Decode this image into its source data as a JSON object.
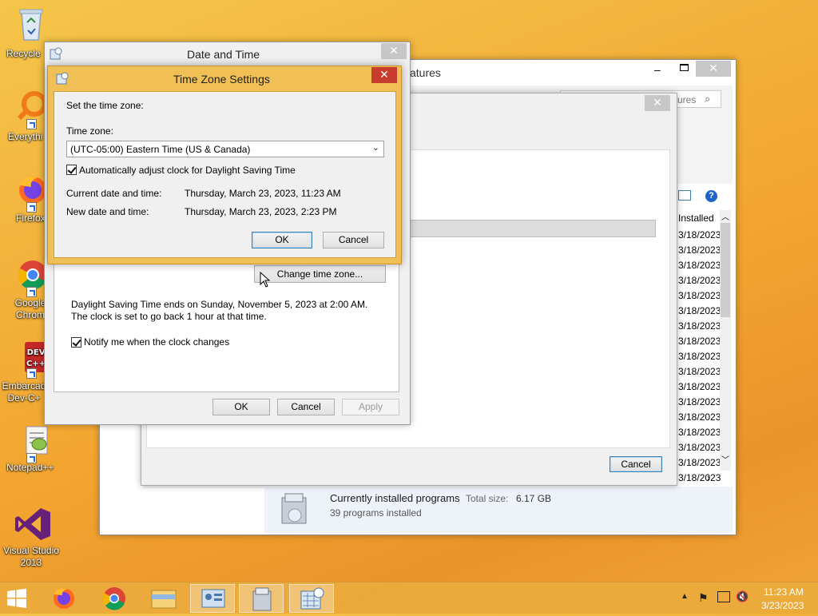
{
  "desktop": {
    "icons": [
      {
        "label": "Recycle"
      },
      {
        "label": "Everythi"
      },
      {
        "label": "Firefox"
      },
      {
        "label": "Google Chrom"
      },
      {
        "label": "Embarcad Dev-C+"
      },
      {
        "label": "Notepad++"
      },
      {
        "label": "Visual Studio 2013"
      }
    ]
  },
  "programs_window": {
    "title_partial": "atures",
    "search_placeholder_partial": "ures",
    "column_header": "Installed",
    "dates": [
      "3/18/2023",
      "3/18/2023",
      "3/18/2023",
      "3/18/2023",
      "3/18/2023",
      "3/18/2023",
      "3/18/2023",
      "3/18/2023",
      "3/18/2023",
      "3/18/2023",
      "3/18/2023",
      "3/18/2023",
      "3/18/2023",
      "3/18/2023",
      "3/18/2023",
      "3/18/2023",
      "3/18/2023"
    ],
    "cancel_label": "Cancel",
    "status": {
      "title": "Currently installed programs",
      "total_size_label": "Total size:",
      "total_size_value": "6.17 GB",
      "count_text": "39 programs installed"
    }
  },
  "date_time_dialog": {
    "title": "Date and Time",
    "change_tz_label": "Change time zone...",
    "dst_info": "Daylight Saving Time ends on Sunday, November 5, 2023 at 2:00 AM. The clock is set to go back 1 hour at that time.",
    "notify_label": "Notify me when the clock changes",
    "notify_checked": true,
    "ok_label": "OK",
    "cancel_label": "Cancel",
    "apply_label": "Apply"
  },
  "tz_dialog": {
    "title": "Time Zone Settings",
    "intro": "Set the time zone:",
    "tz_label": "Time zone:",
    "tz_selected": "(UTC-05:00) Eastern Time (US & Canada)",
    "auto_dst_label": "Automatically adjust clock for Daylight Saving Time",
    "auto_dst_checked": true,
    "current_label": "Current date and time:",
    "current_value": "Thursday, March 23, 2023, 11:23 AM",
    "new_label": "New date and time:",
    "new_value": "Thursday, March 23, 2023, 2:23 PM",
    "ok_label": "OK",
    "cancel_label": "Cancel"
  },
  "taskbar": {
    "clock_time": "11:23 AM",
    "clock_date": "3/23/2023"
  },
  "colors": {
    "tz_frame": "#f0bf55",
    "accent_blue": "#3c7fb1",
    "close_red": "#c73c2c"
  }
}
